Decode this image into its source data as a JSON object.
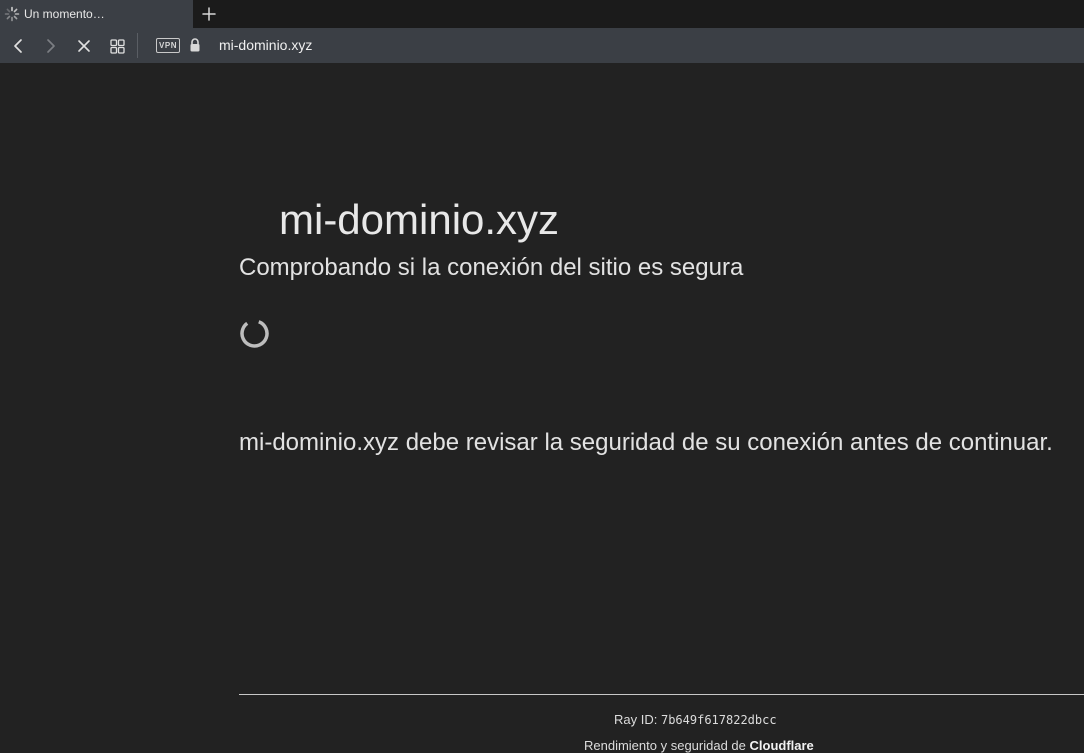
{
  "browser": {
    "tab": {
      "title": "Un momento…",
      "icon": "loading-spinner-icon"
    },
    "new_tab_icon": "plus-icon",
    "toolbar": {
      "back_icon": "chevron-left-icon",
      "forward_icon": "chevron-right-icon",
      "stop_icon": "close-icon",
      "tabs_grid_icon": "grid-icon",
      "vpn_label": "VPN",
      "lock_icon": "lock-icon",
      "url": "mi-dominio.xyz"
    }
  },
  "page": {
    "site_title": "mi-dominio.xyz",
    "subtitle": "Comprobando si la conexión del sitio es segura",
    "spinner_icon": "loading-ring-icon",
    "message": "mi-dominio.xyz debe revisar la seguridad de su conexión antes de continuar.",
    "footer": {
      "ray_label": "Ray ID: ",
      "ray_id": "7b649f617822dbcc",
      "performance_text": "Rendimiento y seguridad de ",
      "provider": "Cloudflare"
    }
  },
  "colors": {
    "page_background": "#222222",
    "toolbar_background": "#3b3f45",
    "tabbar_background": "#1b1b1b",
    "text": "#e2e2e2"
  }
}
